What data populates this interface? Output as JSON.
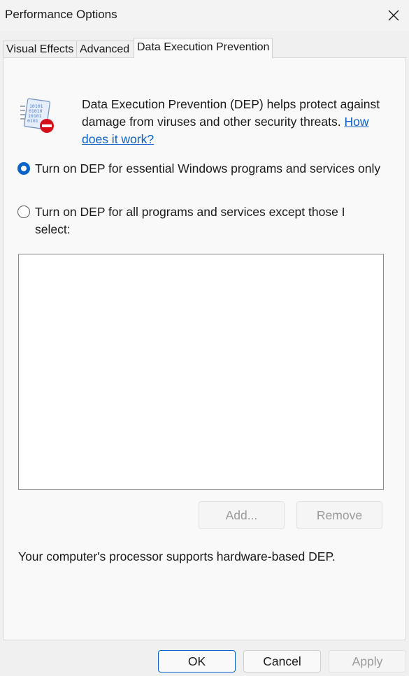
{
  "window": {
    "title": "Performance Options"
  },
  "tabs": [
    {
      "label": "Visual Effects",
      "active": false
    },
    {
      "label": "Advanced",
      "active": false
    },
    {
      "label": "Data Execution Prevention",
      "active": true
    }
  ],
  "dep": {
    "icon": "dep-shield-icon",
    "description": "Data Execution Prevention (DEP) helps protect against damage from viruses and other security threats.",
    "link_text": "How does it work?",
    "options": [
      {
        "label": "Turn on DEP for essential Windows programs and services only",
        "selected": true
      },
      {
        "label": "Turn on DEP for all programs and services except those I select:",
        "selected": false
      }
    ],
    "program_list": [],
    "add_label": "Add...",
    "remove_label": "Remove",
    "status": "Your computer's processor supports hardware-based DEP."
  },
  "footer": {
    "ok_label": "OK",
    "cancel_label": "Cancel",
    "apply_label": "Apply"
  },
  "colors": {
    "accent": "#0a63c9",
    "link": "#0b5fc7",
    "disabled_text": "#9a9a9a"
  }
}
